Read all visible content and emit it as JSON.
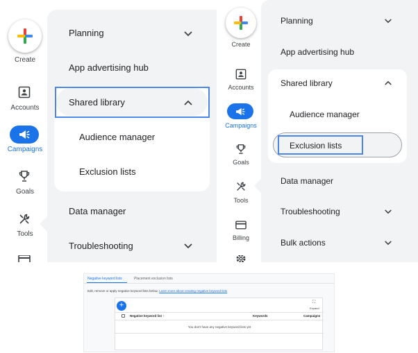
{
  "panel_left": {
    "create_label": "Create",
    "rail": [
      {
        "label": "Accounts",
        "icon": "accounts-icon"
      },
      {
        "label": "Campaigns",
        "icon": "campaigns-icon",
        "active": true
      },
      {
        "label": "Goals",
        "icon": "trophy-icon"
      },
      {
        "label": "Tools",
        "icon": "tools-icon"
      }
    ],
    "menu": {
      "planning": "Planning",
      "app_hub": "App advertising hub",
      "shared_library": "Shared library",
      "audience_manager": "Audience manager",
      "exclusion_lists": "Exclusion lists",
      "data_manager": "Data manager",
      "troubleshooting": "Troubleshooting"
    }
  },
  "panel_right": {
    "create_label": "Create",
    "rail": [
      {
        "label": "Accounts",
        "icon": "accounts-icon"
      },
      {
        "label": "Campaigns",
        "icon": "campaigns-icon",
        "active": true
      },
      {
        "label": "Goals",
        "icon": "trophy-icon"
      },
      {
        "label": "Tools",
        "icon": "tools-icon"
      },
      {
        "label": "Billing",
        "icon": "billing-icon"
      }
    ],
    "menu": {
      "planning": "Planning",
      "app_hub": "App advertising hub",
      "shared_library": "Shared library",
      "audience_manager": "Audience manager",
      "exclusion_lists": "Exclusion lists",
      "data_manager": "Data manager",
      "troubleshooting": "Troubleshooting",
      "bulk_actions": "Bulk actions"
    }
  },
  "bottom": {
    "tabs": [
      "Negative keyword lists",
      "Placement exclusion lists"
    ],
    "description": "Edit, remove or apply negative keyword lists below.",
    "description_link": "Learn more about creating negative keyword lists",
    "expand_label": "Expand",
    "columns": [
      "Negative keyword list",
      "Keywords",
      "Campaigns"
    ],
    "empty_message": "You don't have any negative keyword lists yet"
  },
  "colors": {
    "accent": "#1a73e8",
    "highlight": "#4a86e8",
    "menu_bg": "#f1f3f4"
  }
}
